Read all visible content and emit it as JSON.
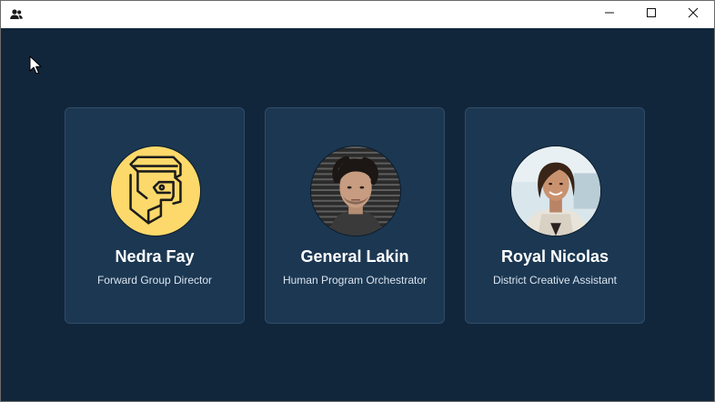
{
  "window": {
    "app_icon": "people-icon",
    "controls": [
      "minimize-icon",
      "maximize-icon",
      "close-icon"
    ]
  },
  "cards": [
    {
      "name": "Nedra Fay",
      "role": "Forward Group Director",
      "avatar": "robot-face-illustration"
    },
    {
      "name": "General Lakin",
      "role": "Human Program Orchestrator",
      "avatar": "man-portrait-photo"
    },
    {
      "name": "Royal Nicolas",
      "role": "District Creative Assistant",
      "avatar": "woman-portrait-photo"
    }
  ],
  "colors": {
    "background": "#12263b",
    "card": "#1b3752",
    "card_border": "#2f4c68",
    "avatar_yellow": "#fcd96a"
  }
}
